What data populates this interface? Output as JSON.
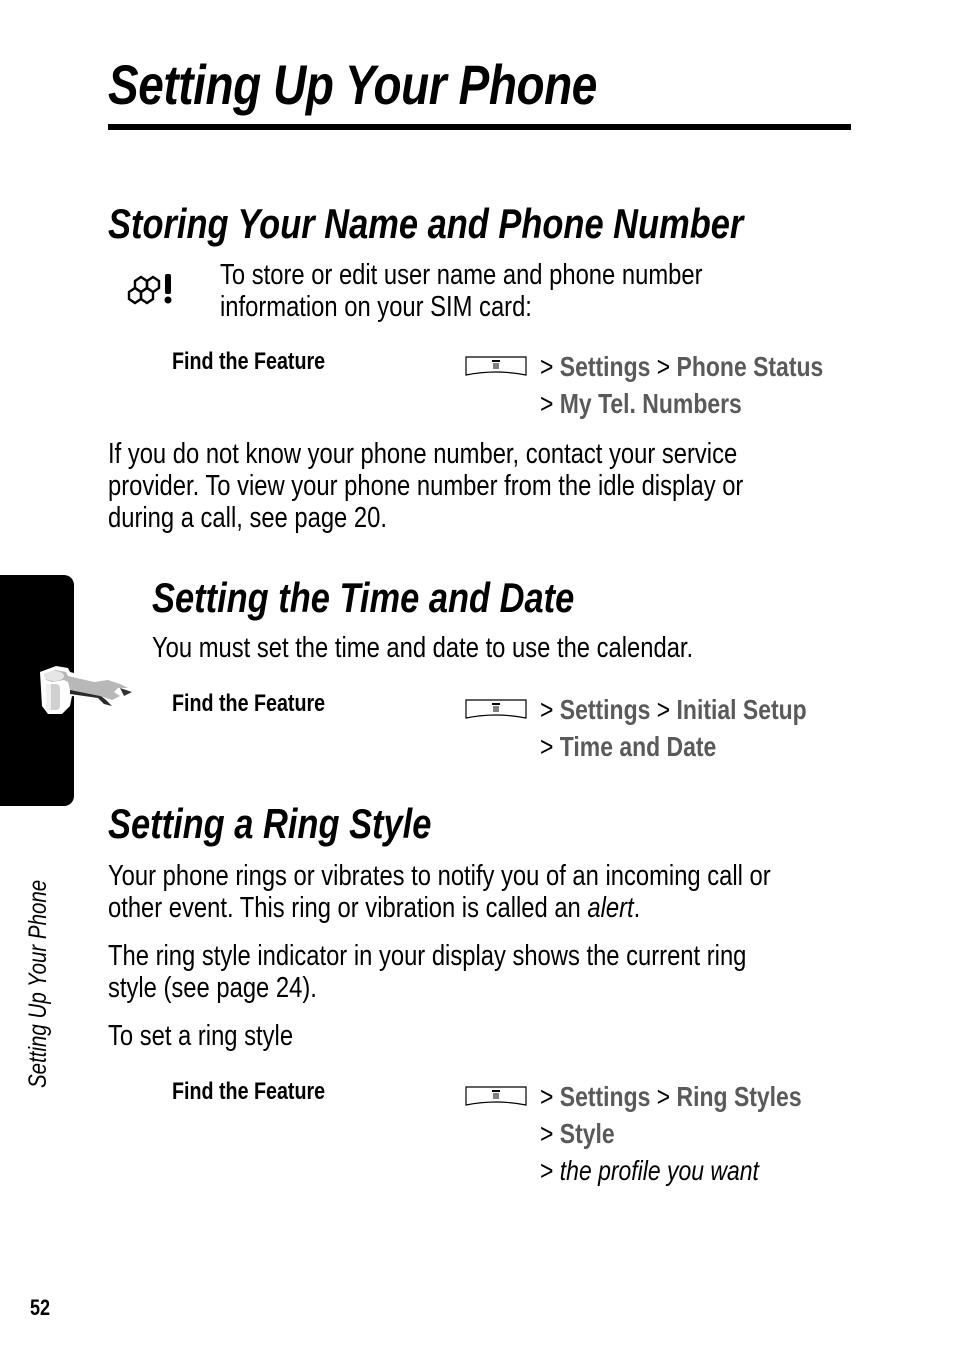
{
  "page": {
    "title": "Setting Up Your Phone",
    "side_tab_label": "Setting Up Your Phone",
    "page_number": "52"
  },
  "icons": {
    "sim_icon": "sim-card-icon",
    "wrench_icon": "wrench-icon",
    "menu_key": "menu-key-icon"
  },
  "colors": {
    "menu_item_text": "#5a5a5a",
    "text": "#000000"
  },
  "sections": [
    {
      "heading": "Storing Your Name and Phone Number",
      "intro_line1": "To store or edit user name and phone number",
      "intro_line2": "information on your SIM card:",
      "find_feature_label": "Find the Feature",
      "path": {
        "line1": [
          ">",
          "Settings",
          ">",
          "Phone Status"
        ],
        "line2": [
          ">",
          "My Tel. Numbers"
        ]
      },
      "paragraph_lines": [
        "If you do not know your phone number, contact your service",
        "provider. To view your phone number from the idle display or",
        "during a call, see page 20."
      ]
    },
    {
      "heading": "Setting the Time and Date",
      "intro": "You must set the time and date to use the calendar.",
      "find_feature_label": "Find the Feature",
      "path": {
        "line1": [
          ">",
          "Settings",
          ">",
          "Initial Setup"
        ],
        "line2": [
          ">",
          "Time and Date"
        ]
      }
    },
    {
      "heading": "Setting a Ring Style",
      "para1_line1": "Your phone rings or vibrates to notify you of an incoming call or",
      "para1_line2_prefix": "other event. This ring or vibration is called an ",
      "para1_line2_em": "alert",
      "para1_line2_suffix": ".",
      "para2_lines": [
        "The ring style indicator in your display shows the current ring",
        "style (see page 24)."
      ],
      "para3": "To set a ring style",
      "find_feature_label": "Find the Feature",
      "path": {
        "line1": [
          ">",
          "Settings",
          ">",
          "Ring Styles"
        ],
        "line2": [
          ">",
          "Style"
        ],
        "line3": [
          ">",
          "the profile you want"
        ]
      }
    }
  ]
}
